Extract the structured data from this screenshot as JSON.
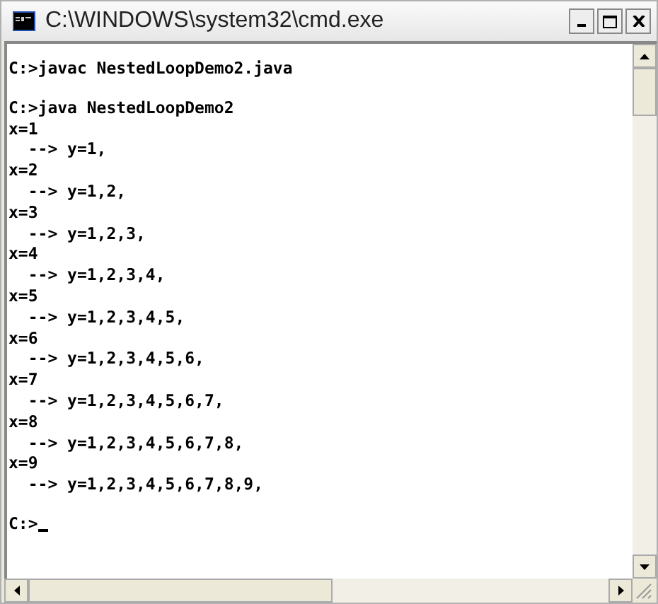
{
  "window": {
    "title": "C:\\WINDOWS\\system32\\cmd.exe"
  },
  "console": {
    "blocks": [
      [
        "C:>javac NestedLoopDemo2.java"
      ],
      [
        "C:>java NestedLoopDemo2",
        "x=1",
        "  --> y=1,",
        "x=2",
        "  --> y=1,2,",
        "x=3",
        "  --> y=1,2,3,",
        "x=4",
        "  --> y=1,2,3,4,",
        "x=5",
        "  --> y=1,2,3,4,5,",
        "x=6",
        "  --> y=1,2,3,4,5,6,",
        "x=7",
        "  --> y=1,2,3,4,5,6,7,",
        "x=8",
        "  --> y=1,2,3,4,5,6,7,8,",
        "x=9",
        "  --> y=1,2,3,4,5,6,7,8,9,"
      ],
      [
        "C:>"
      ]
    ]
  }
}
